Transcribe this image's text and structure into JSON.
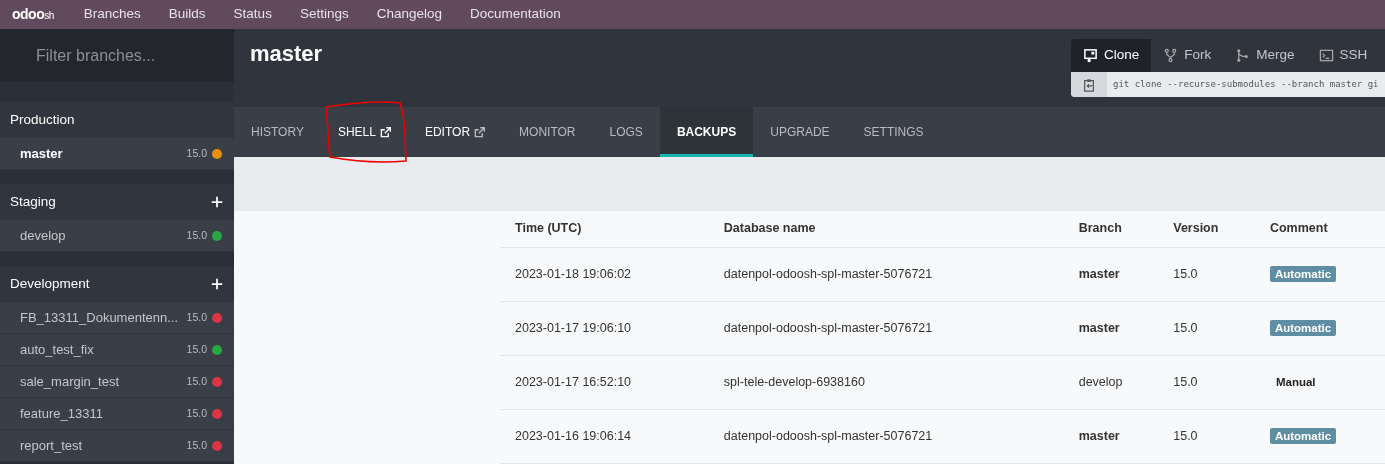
{
  "navbar": {
    "logo": "odoo",
    "logo_suffix": "sh",
    "items": [
      "Branches",
      "Builds",
      "Status",
      "Settings",
      "Changelog",
      "Documentation"
    ]
  },
  "sidebar": {
    "filter": {
      "placeholder": "Filter branches..."
    },
    "sections": [
      {
        "title": "Production",
        "can_add": false,
        "branches": [
          {
            "name": "master",
            "version": "15.0",
            "color": "#e8900c",
            "selected": true
          }
        ]
      },
      {
        "title": "Staging",
        "can_add": true,
        "branches": [
          {
            "name": "develop",
            "version": "15.0",
            "color": "#28a745",
            "selected": false
          }
        ]
      },
      {
        "title": "Development",
        "can_add": true,
        "branches": [
          {
            "name": "FB_13311_Dokumentenn...",
            "version": "15.0",
            "color": "#dc3545",
            "selected": false
          },
          {
            "name": "auto_test_fix",
            "version": "15.0",
            "color": "#28a745",
            "selected": false
          },
          {
            "name": "sale_margin_test",
            "version": "15.0",
            "color": "#dc3545",
            "selected": false
          },
          {
            "name": "feature_13311",
            "version": "15.0",
            "color": "#dc3545",
            "selected": false
          },
          {
            "name": "report_test",
            "version": "15.0",
            "color": "#dc3545",
            "selected": false
          }
        ]
      }
    ]
  },
  "branch_title": "master",
  "git_panel": {
    "tabs": [
      {
        "label": "Clone",
        "kind": "clone",
        "selected": true
      },
      {
        "label": "Fork",
        "kind": "fork",
        "selected": false
      },
      {
        "label": "Merge",
        "kind": "merge",
        "selected": false
      },
      {
        "label": "SSH",
        "kind": "terminal",
        "selected": false
      }
    ],
    "command": "git clone --recurse-submodules --branch master gi"
  },
  "tabs": [
    {
      "label": "HISTORY",
      "external": false,
      "selected": false
    },
    {
      "label": "SHELL",
      "external": true,
      "selected": false
    },
    {
      "label": "EDITOR",
      "external": true,
      "selected": false
    },
    {
      "label": "MONITOR",
      "external": false,
      "selected": false
    },
    {
      "label": "LOGS",
      "external": false,
      "selected": false
    },
    {
      "label": "BACKUPS",
      "external": false,
      "selected": true
    },
    {
      "label": "UPGRADE",
      "external": false,
      "selected": false
    },
    {
      "label": "SETTINGS",
      "external": false,
      "selected": false
    }
  ],
  "table": {
    "columns": [
      "Time (UTC)",
      "Database name",
      "Branch",
      "Version",
      "Comment"
    ],
    "rows": [
      {
        "time": "2023-01-18 19:06:02",
        "database": "datenpol-odoosh-spl-master-5076721",
        "branch": "master",
        "branch_bold": true,
        "version": "15.0",
        "comment": "Automatic",
        "kind": "automatic"
      },
      {
        "time": "2023-01-17 19:06:10",
        "database": "datenpol-odoosh-spl-master-5076721",
        "branch": "master",
        "branch_bold": true,
        "version": "15.0",
        "comment": "Automatic",
        "kind": "automatic"
      },
      {
        "time": "2023-01-17 16:52:10",
        "database": "spl-tele-develop-6938160",
        "branch": "develop",
        "branch_bold": false,
        "version": "15.0",
        "comment": "Manual",
        "kind": "manual"
      },
      {
        "time": "2023-01-16 19:06:14",
        "database": "datenpol-odoosh-spl-master-5076721",
        "branch": "master",
        "branch_bold": true,
        "version": "15.0",
        "comment": "Automatic",
        "kind": "automatic"
      }
    ]
  }
}
